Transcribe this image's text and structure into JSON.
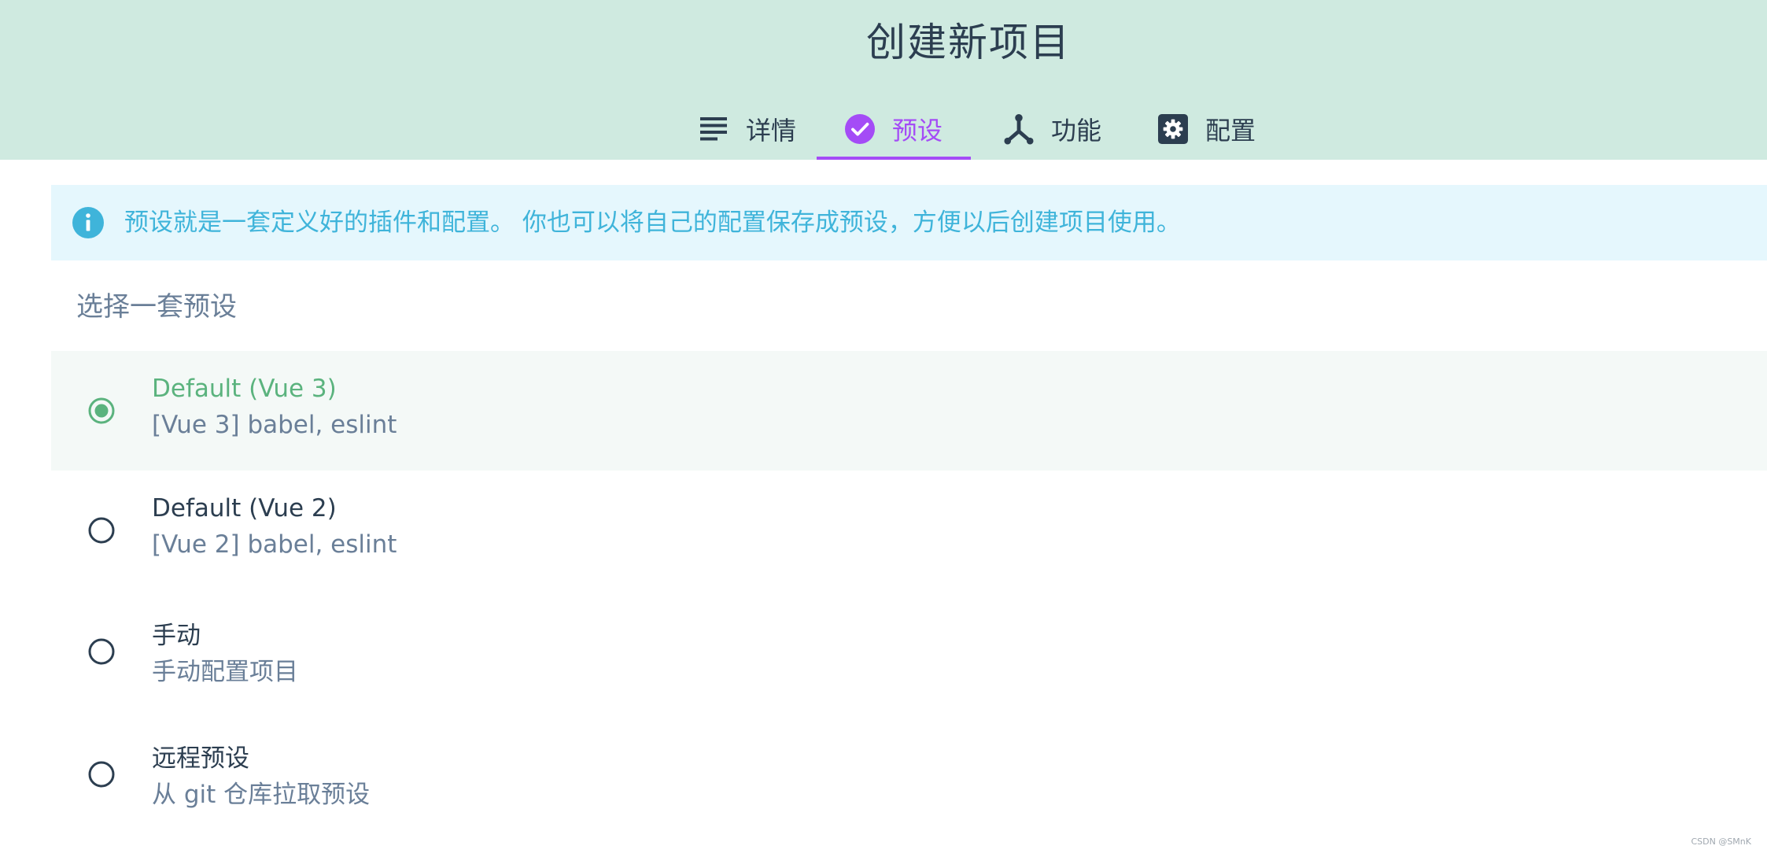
{
  "header": {
    "title": "创建新项目"
  },
  "tabs": [
    {
      "label": "详情",
      "icon": "list-icon",
      "active": false
    },
    {
      "label": "预设",
      "icon": "check-circle-icon",
      "active": true
    },
    {
      "label": "功能",
      "icon": "fork-icon",
      "active": false
    },
    {
      "label": "配置",
      "icon": "gear-icon",
      "active": false
    }
  ],
  "info_banner": {
    "icon": "info-icon",
    "text": "预设就是一套定义好的插件和配置。 你也可以将自己的配置保存成预设，方便以后创建项目使用。"
  },
  "section_title": "选择一套预设",
  "presets": [
    {
      "name": "Default (Vue 3)",
      "description": "[Vue 3] babel, eslint",
      "selected": true
    },
    {
      "name": "Default (Vue 2)",
      "description": "[Vue 2] babel, eslint",
      "selected": false
    },
    {
      "name": "手动",
      "description": "手动配置项目",
      "selected": false
    },
    {
      "name": "远程预设",
      "description": "从 git 仓库拉取预设",
      "selected": false
    }
  ],
  "watermark": "CSDN @SMnK",
  "colors": {
    "header_bg": "#cfeae0",
    "accent_purple": "#a44cf6",
    "accent_green": "#5bb37e",
    "info_blue": "#3fb4da",
    "info_bg": "#e5f7fd",
    "text_dark": "#2c3e50",
    "text_muted": "#6a7f98"
  }
}
